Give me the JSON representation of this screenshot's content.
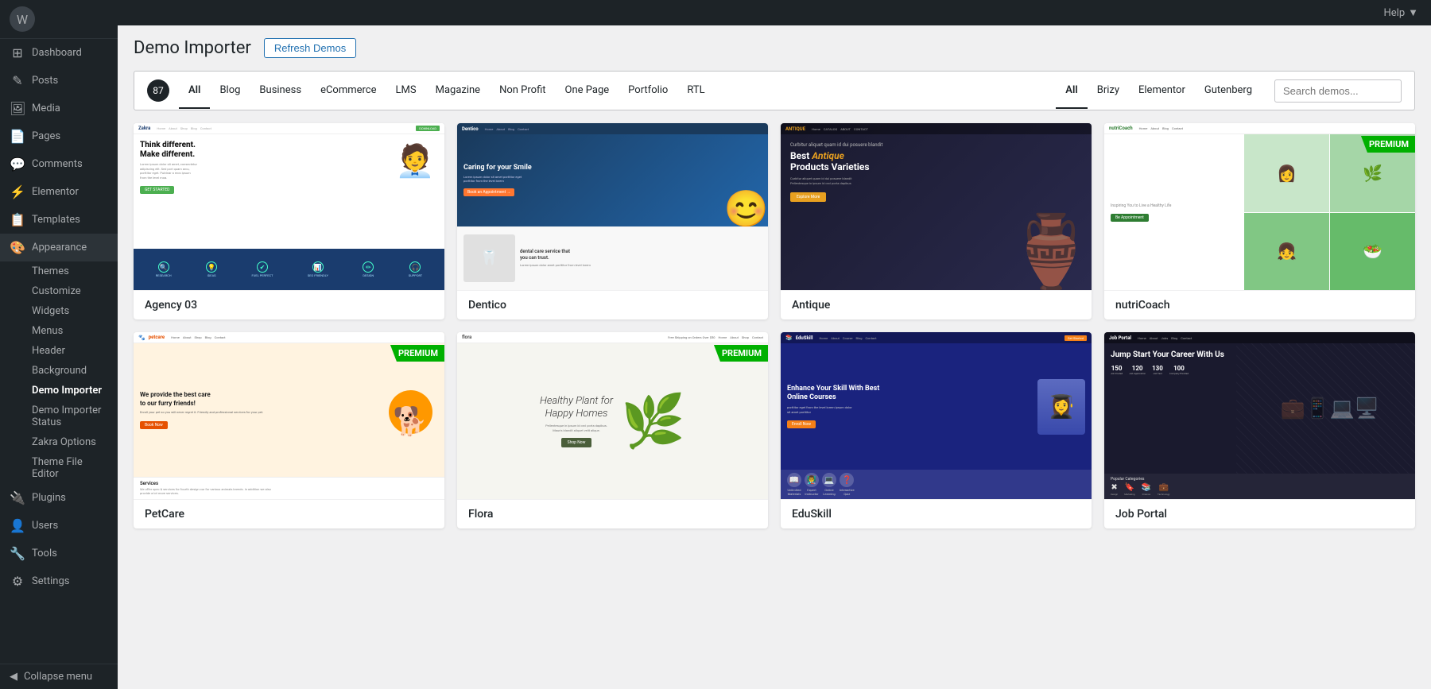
{
  "sidebar": {
    "items": [
      {
        "label": "Dashboard",
        "icon": "⊞",
        "active": false
      },
      {
        "label": "Posts",
        "icon": "✎",
        "active": false
      },
      {
        "label": "Media",
        "icon": "🖼",
        "active": false
      },
      {
        "label": "Pages",
        "icon": "📄",
        "active": false
      },
      {
        "label": "Comments",
        "icon": "💬",
        "active": false
      },
      {
        "label": "Elementor",
        "icon": "⚡",
        "active": false
      },
      {
        "label": "Templates",
        "icon": "📋",
        "active": false
      }
    ],
    "appearance": {
      "label": "Appearance",
      "icon": "🎨",
      "sub_items": [
        {
          "label": "Themes",
          "active": false
        },
        {
          "label": "Customize",
          "active": false
        },
        {
          "label": "Widgets",
          "active": false
        },
        {
          "label": "Menus",
          "active": false
        },
        {
          "label": "Header",
          "active": false
        },
        {
          "label": "Background",
          "active": false
        },
        {
          "label": "Demo Importer",
          "active": true
        },
        {
          "label": "Demo Importer Status",
          "active": false
        },
        {
          "label": "Zakra Options",
          "active": false
        },
        {
          "label": "Theme File Editor",
          "active": false
        }
      ]
    },
    "bottom_items": [
      {
        "label": "Plugins",
        "icon": "🔌"
      },
      {
        "label": "Users",
        "icon": "👤"
      },
      {
        "label": "Tools",
        "icon": "🔧"
      },
      {
        "label": "Settings",
        "icon": "⚙"
      }
    ],
    "collapse_label": "Collapse menu"
  },
  "topbar": {
    "help_label": "Help"
  },
  "header": {
    "title": "Demo Importer",
    "refresh_btn": "Refresh Demos"
  },
  "filter_bar": {
    "count": "87",
    "tabs": [
      {
        "label": "All",
        "active": true
      },
      {
        "label": "Blog",
        "active": false
      },
      {
        "label": "Business",
        "active": false
      },
      {
        "label": "eCommerce",
        "active": false
      },
      {
        "label": "LMS",
        "active": false
      },
      {
        "label": "Magazine",
        "active": false
      },
      {
        "label": "Non Profit",
        "active": false
      },
      {
        "label": "One Page",
        "active": false
      },
      {
        "label": "Portfolio",
        "active": false
      },
      {
        "label": "RTL",
        "active": false
      }
    ],
    "builder_tabs": [
      {
        "label": "All",
        "active": true
      },
      {
        "label": "Brizy",
        "active": false
      },
      {
        "label": "Elementor",
        "active": false
      },
      {
        "label": "Gutenberg",
        "active": false
      }
    ],
    "search_placeholder": "Search demos..."
  },
  "demos": [
    {
      "name": "Agency 03",
      "premium": false,
      "type": "agency"
    },
    {
      "name": "Dentico",
      "premium": true,
      "type": "dental"
    },
    {
      "name": "Antique",
      "premium": true,
      "type": "antique"
    },
    {
      "name": "nutriCoach",
      "premium": true,
      "type": "nutrition"
    },
    {
      "name": "PetCare",
      "premium": true,
      "type": "petcare"
    },
    {
      "name": "Flora",
      "premium": true,
      "type": "flora"
    },
    {
      "name": "EduSkill",
      "premium": false,
      "type": "eduskill"
    },
    {
      "name": "Job Portal",
      "premium": false,
      "type": "jobportal"
    }
  ],
  "premium_badge_label": "PREMIUM",
  "jump_start_text": "Jump Start Your Career With Us"
}
